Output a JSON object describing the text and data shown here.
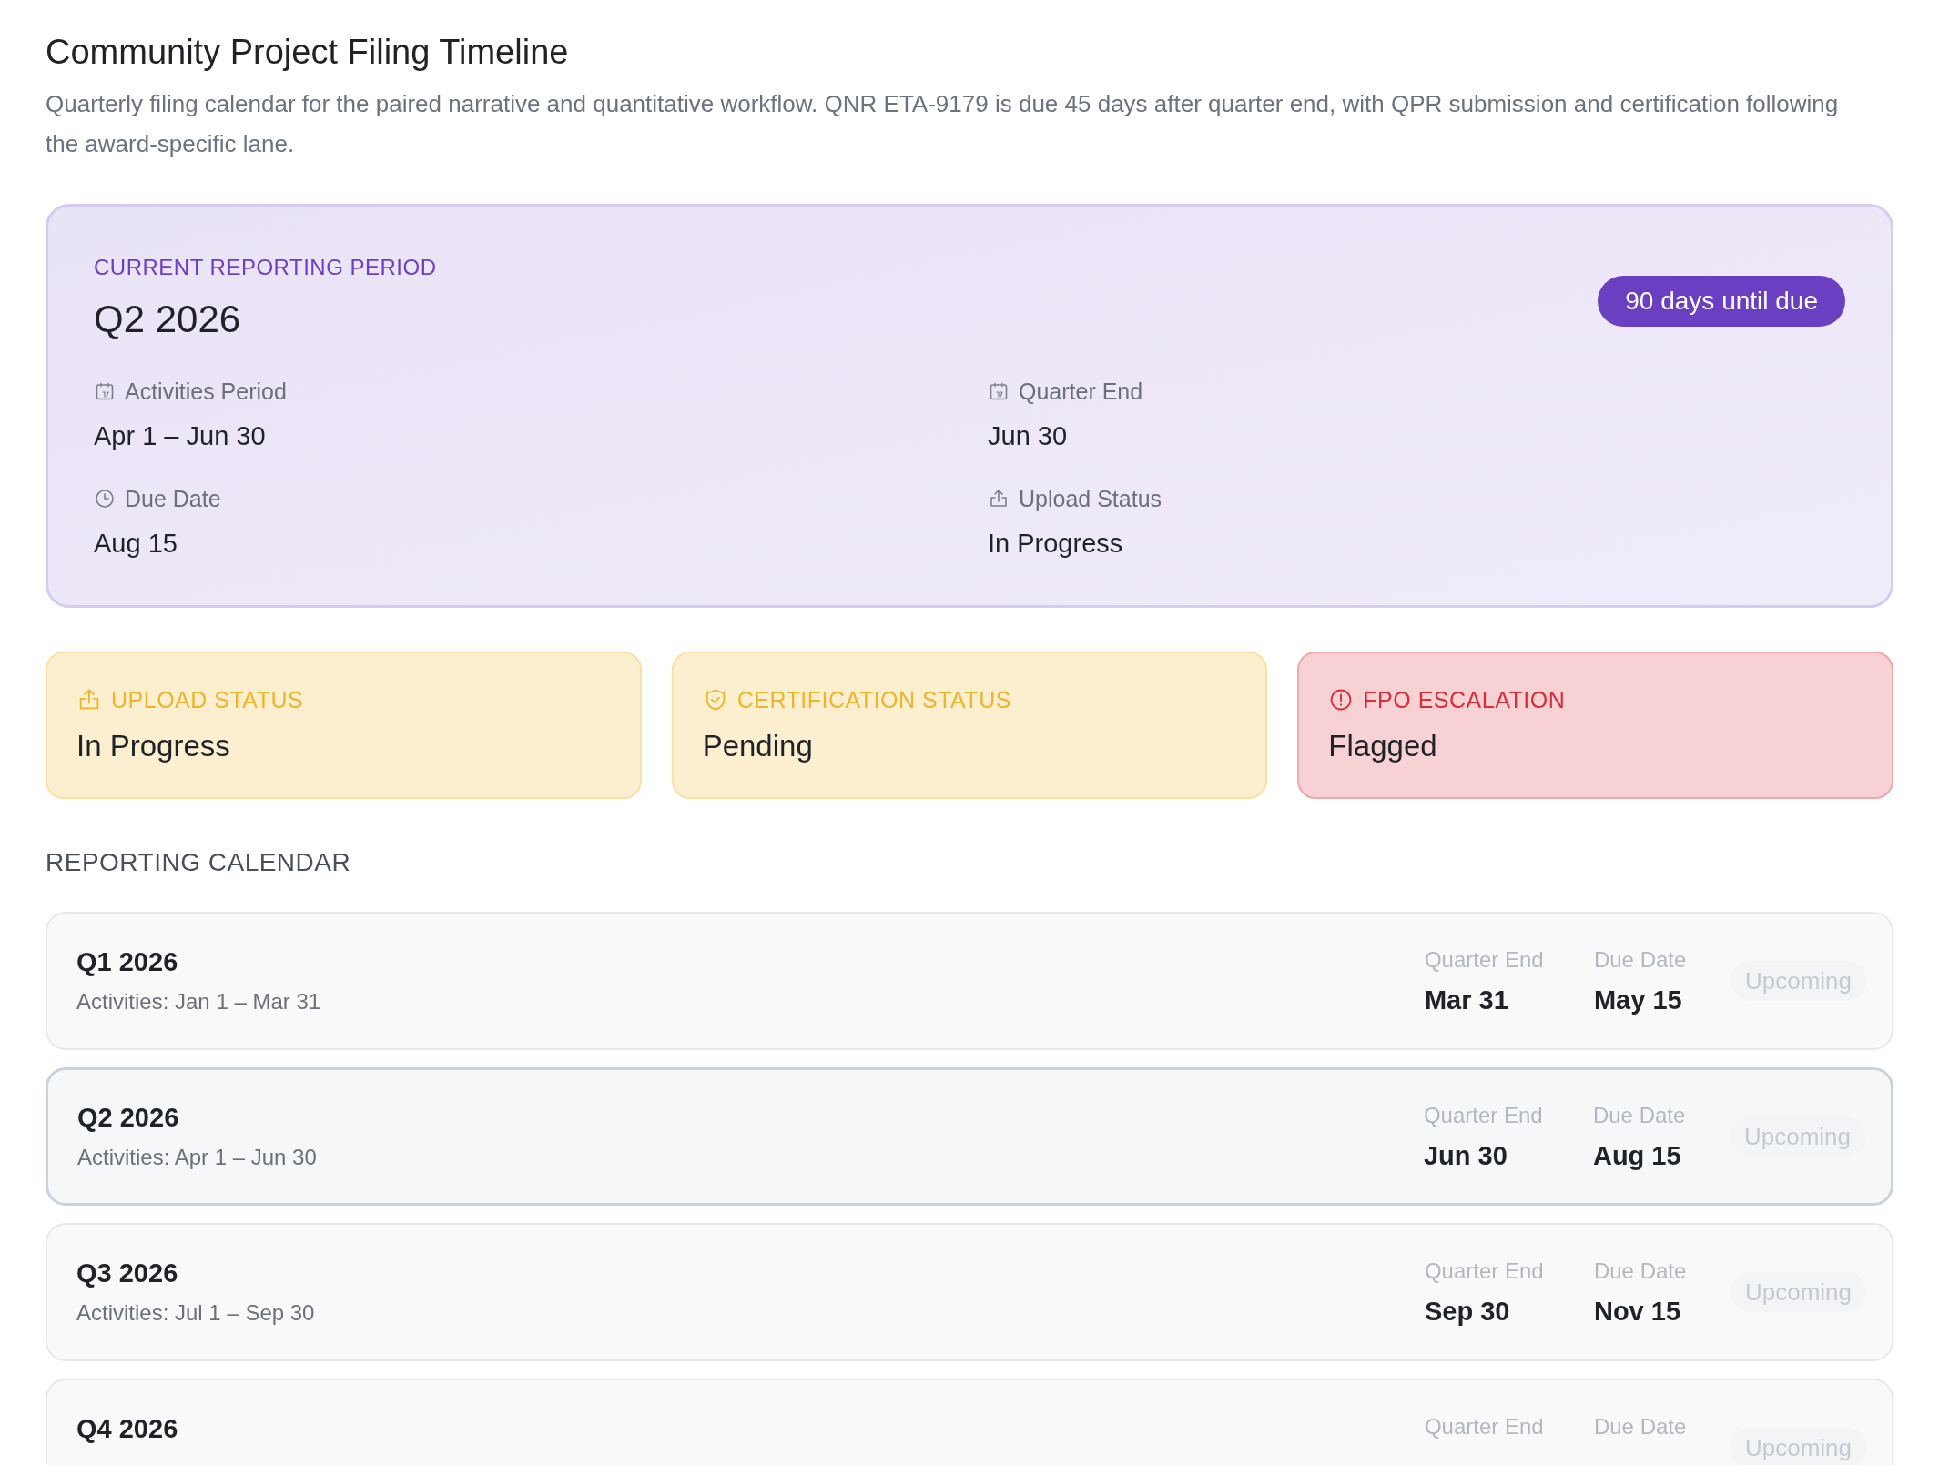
{
  "page": {
    "title": "Community Project Filing Timeline",
    "description": "Quarterly filing calendar for the paired narrative and quantitative workflow. QNR ETA-9179 is due 45 days after quarter end, with QPR submission and certification following the award-specific lane."
  },
  "current_period": {
    "label": "CURRENT REPORTING PERIOD",
    "period": "Q2 2026",
    "badge": "90 days until due",
    "fields": [
      {
        "kind": "calendar",
        "label": "Activities Period",
        "value": "Apr 1 – Jun 30"
      },
      {
        "kind": "calendar",
        "label": "Quarter End",
        "value": "Jun 30"
      },
      {
        "kind": "clock",
        "label": "Due Date",
        "value": "Aug 15"
      },
      {
        "kind": "upload",
        "label": "Upload Status",
        "value": "In Progress"
      }
    ]
  },
  "status_cards": [
    {
      "kind": "upload",
      "color": "#f0b429",
      "label": "UPLOAD STATUS",
      "value": "In Progress"
    },
    {
      "kind": "shield",
      "color": "#f0b429",
      "label": "CERTIFICATION STATUS",
      "value": "Pending"
    },
    {
      "kind": "alert",
      "color": "#d92d3a",
      "label": "FPO ESCALATION",
      "value": "Flagged"
    }
  ],
  "calendar": {
    "heading": "REPORTING CALENDAR",
    "rows": [
      {
        "quarter": "Q1 2026",
        "activities": "Activities: Jan 1 – Mar 31",
        "quarter_end_label": "Quarter End",
        "quarter_end": "Mar 31",
        "due_label": "Due Date",
        "due": "May 15",
        "status": "Upcoming",
        "selected": false
      },
      {
        "quarter": "Q2 2026",
        "activities": "Activities: Apr 1 – Jun 30",
        "quarter_end_label": "Quarter End",
        "quarter_end": "Jun 30",
        "due_label": "Due Date",
        "due": "Aug 15",
        "status": "Upcoming",
        "selected": true
      },
      {
        "quarter": "Q3 2026",
        "activities": "Activities: Jul 1 – Sep 30",
        "quarter_end_label": "Quarter End",
        "quarter_end": "Sep 30",
        "due_label": "Due Date",
        "due": "Nov 15",
        "status": "Upcoming",
        "selected": false
      },
      {
        "quarter": "Q4 2026",
        "quarter_end_label": "Quarter End",
        "due_label": "Due Date",
        "status": "Upcoming",
        "selected": false
      }
    ]
  }
}
